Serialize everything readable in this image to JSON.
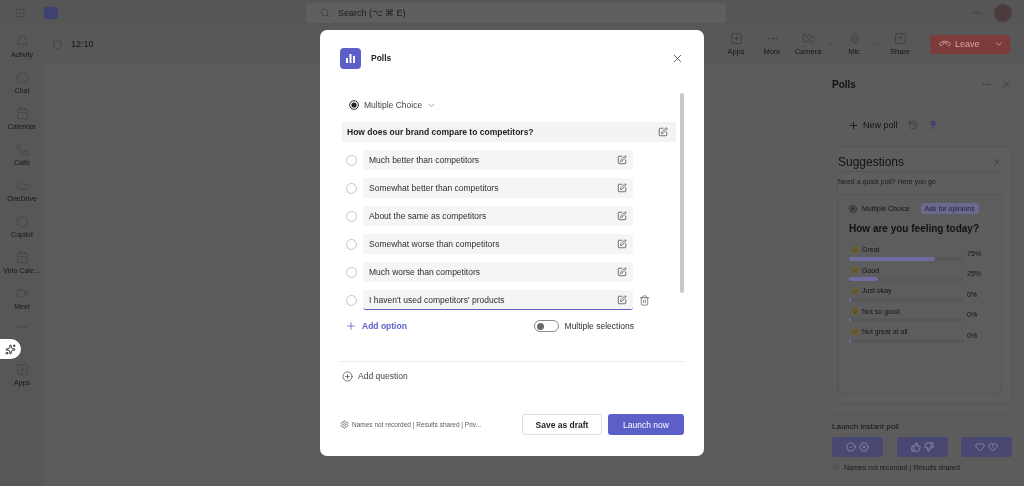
{
  "top_bar": {
    "search": {
      "placeholder": "Search (⌥ ⌘ E)"
    }
  },
  "rail": {
    "items": [
      {
        "label": "Activity"
      },
      {
        "label": "Chat"
      },
      {
        "label": "Calendar"
      },
      {
        "label": "Calls"
      },
      {
        "label": "OneDrive"
      },
      {
        "label": "Copilot"
      },
      {
        "label": "Virto Cale…"
      },
      {
        "label": "Meet"
      }
    ],
    "apps": "Apps"
  },
  "meeting": {
    "timer": "12:10",
    "controls": [
      {
        "label": "Apps",
        "menu": false
      },
      {
        "label": "More",
        "menu": false
      },
      {
        "label": "Camera",
        "menu": true
      },
      {
        "label": "Mic",
        "menu": true
      },
      {
        "label": "Share",
        "menu": false
      }
    ],
    "leave": "Leave"
  },
  "modal": {
    "title": "Polls",
    "question_type": "Multiple Choice",
    "question": "How does our brand compare to competitors?",
    "options": [
      {
        "text": "Much better than competitors",
        "focused": false,
        "checked": false
      },
      {
        "text": "Somewhat better than competitors",
        "focused": false,
        "checked": false
      },
      {
        "text": "About the same as competitors",
        "focused": false,
        "checked": false
      },
      {
        "text": "Somewhat worse than competitors",
        "focused": false,
        "checked": false
      },
      {
        "text": "Much worse than competitors",
        "focused": false,
        "checked": false
      },
      {
        "text": "I haven't used competitors' products",
        "focused": true,
        "checked": false
      }
    ],
    "add_option": "Add option",
    "multiple_selections": {
      "label": "Multiple selections",
      "on": false
    },
    "add_question": "Add question",
    "privacy_note": "Names not recorded | Results shared | Priv...",
    "save_draft": "Save as draft",
    "launch": "Launch now"
  },
  "side_panel": {
    "title": "Polls",
    "new_poll": "New poll",
    "suggestions": {
      "title": "Suggestions",
      "subtitle": "Need a quick poll? Here you go",
      "card": {
        "type": "Multiple Choice",
        "tag": "Ask for opinions",
        "question": "How are you feeling today?",
        "results": [
          {
            "label": "Great",
            "percent": "75%",
            "level": 0.75
          },
          {
            "label": "Good",
            "percent": "25%",
            "level": 0.25
          },
          {
            "label": "Just okay",
            "percent": "0%",
            "level": 0
          },
          {
            "label": "Not so good",
            "percent": "0%",
            "level": 0
          },
          {
            "label": "Not great at all",
            "percent": "0%",
            "level": 0
          }
        ]
      }
    },
    "launch_instant_poll": "Launch instant poll",
    "footer_note": "Names not recorded | Results shared"
  }
}
